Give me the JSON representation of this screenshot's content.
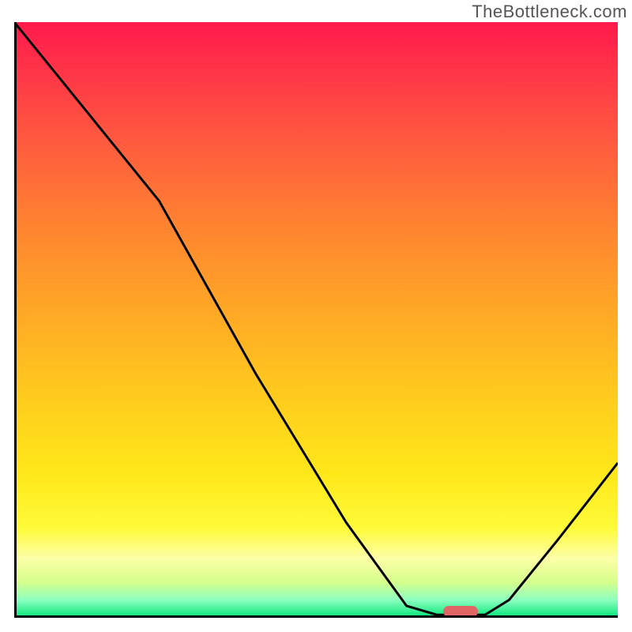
{
  "watermark": "TheBottleneck.com",
  "colors": {
    "curve_stroke": "#000000",
    "axis_stroke": "#000000",
    "marker_fill": "#e06666",
    "gradient_top": "#ff1a4b",
    "gradient_bottom": "#00e676"
  },
  "chart_data": {
    "type": "line",
    "title": "",
    "xlabel": "",
    "ylabel": "",
    "x_range": [
      0,
      100
    ],
    "y_range": [
      0,
      100
    ],
    "note": "Axes have no visible tick labels; x/y are normalized 0-100.",
    "series": [
      {
        "name": "curve",
        "points": [
          {
            "x": 0,
            "y": 100
          },
          {
            "x": 12,
            "y": 85
          },
          {
            "x": 24,
            "y": 70
          },
          {
            "x": 40,
            "y": 41
          },
          {
            "x": 55,
            "y": 16
          },
          {
            "x": 65,
            "y": 2
          },
          {
            "x": 70,
            "y": 0.5
          },
          {
            "x": 78,
            "y": 0.5
          },
          {
            "x": 82,
            "y": 3
          },
          {
            "x": 90,
            "y": 13
          },
          {
            "x": 100,
            "y": 26
          }
        ]
      }
    ],
    "marker": {
      "x": 74,
      "y": 1,
      "shape": "pill",
      "color": "#e06666"
    }
  }
}
